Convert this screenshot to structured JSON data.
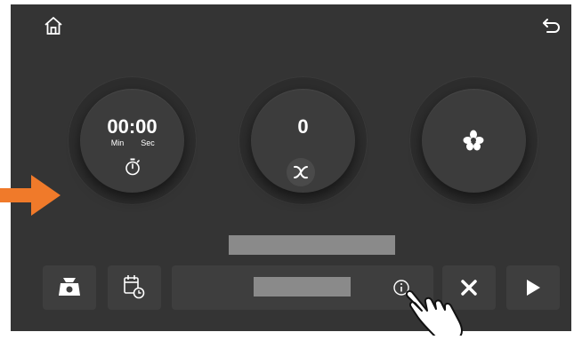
{
  "timer": {
    "time": "00:00",
    "min_label": "Min",
    "sec_label": "Sec"
  },
  "fan": {
    "speed": "0"
  },
  "icons": {
    "home": "home-icon",
    "back": "back-arrow-icon",
    "stopwatch": "stopwatch-icon",
    "fan": "fan-icon",
    "flower": "flower-icon",
    "scale": "scale-icon",
    "calendar": "calendar-clock-icon",
    "info": "info-icon",
    "cancel": "close-icon",
    "play": "play-icon",
    "hand": "hand-pointer-icon",
    "arrow": "right-arrow-indicator"
  },
  "colors": {
    "background": "#343434",
    "arrow": "#f07a2a",
    "text": "#ffffff"
  }
}
